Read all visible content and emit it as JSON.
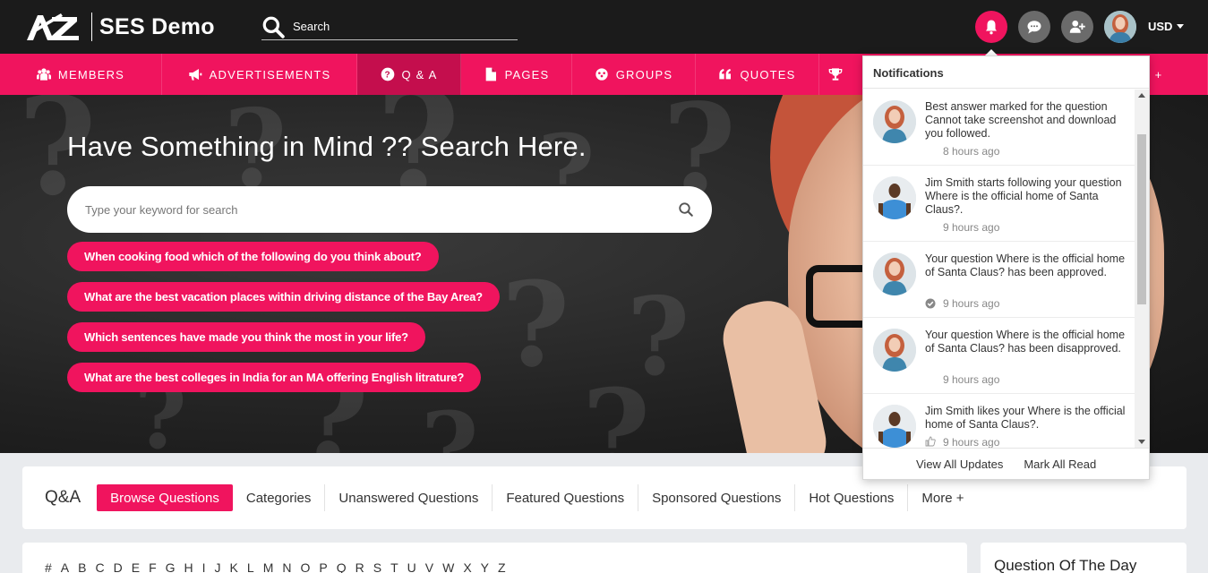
{
  "header": {
    "site_name": "SES Demo",
    "search_placeholder": "Search",
    "currency": "USD"
  },
  "nav": {
    "items": [
      {
        "label": "MEMBERS",
        "icon": "members-icon"
      },
      {
        "label": "ADVERTISEMENTS",
        "icon": "megaphone-icon"
      },
      {
        "label": "Q & A",
        "icon": "question-icon",
        "active": true
      },
      {
        "label": "PAGES",
        "icon": "page-icon"
      },
      {
        "label": "GROUPS",
        "icon": "groups-icon"
      },
      {
        "label": "QUOTES",
        "icon": "quote-icon"
      },
      {
        "label": "",
        "icon": "trophy-icon"
      }
    ],
    "more_label": "E +"
  },
  "hero": {
    "title": "Have Something in Mind ?? Search Here.",
    "search_placeholder": "Type your keyword for search",
    "suggestions": [
      "When cooking food which of the following do you think about?",
      "What are the best vacation places within driving distance of the Bay Area?",
      "Which sentences have made you think the most in your life?",
      "What are the best colleges in India for an MA offering English litrature?"
    ]
  },
  "tabs": {
    "title": "Q&A",
    "items": [
      "Browse Questions",
      "Categories",
      "Unanswered Questions",
      "Featured Questions",
      "Sponsored Questions",
      "Hot Questions",
      "More +"
    ]
  },
  "alphabet": [
    "#",
    "A",
    "B",
    "C",
    "D",
    "E",
    "F",
    "G",
    "H",
    "I",
    "J",
    "K",
    "L",
    "M",
    "N",
    "O",
    "P",
    "Q",
    "R",
    "S",
    "T",
    "U",
    "V",
    "W",
    "X",
    "Y",
    "Z"
  ],
  "sidebar": {
    "title": "Question Of The Day"
  },
  "notifications": {
    "title": "Notifications",
    "items": [
      {
        "text": "Best answer marked for the question Cannot take screenshot and download you followed.",
        "time": "8 hours ago",
        "avatar": "woman",
        "icon": ""
      },
      {
        "text": "Jim Smith starts following your question Where is the official home of Santa Claus?.",
        "time": "9 hours ago",
        "avatar": "man",
        "icon": ""
      },
      {
        "text": "Your question Where is the official home of Santa Claus? has been approved.",
        "time": "9 hours ago",
        "avatar": "woman",
        "icon": "check-circle-icon"
      },
      {
        "text": "Your question Where is the official home of Santa Claus? has been disapproved.",
        "time": "9 hours ago",
        "avatar": "woman",
        "icon": ""
      },
      {
        "text": "Jim Smith likes your Where is the official home of Santa Claus?.",
        "time": "9 hours ago",
        "avatar": "man",
        "icon": "thumbs-up-icon"
      }
    ],
    "view_all": "View All Updates",
    "mark_all": "Mark All Read"
  },
  "colors": {
    "accent": "#f0145e",
    "header_bg": "#1b1b1b"
  }
}
